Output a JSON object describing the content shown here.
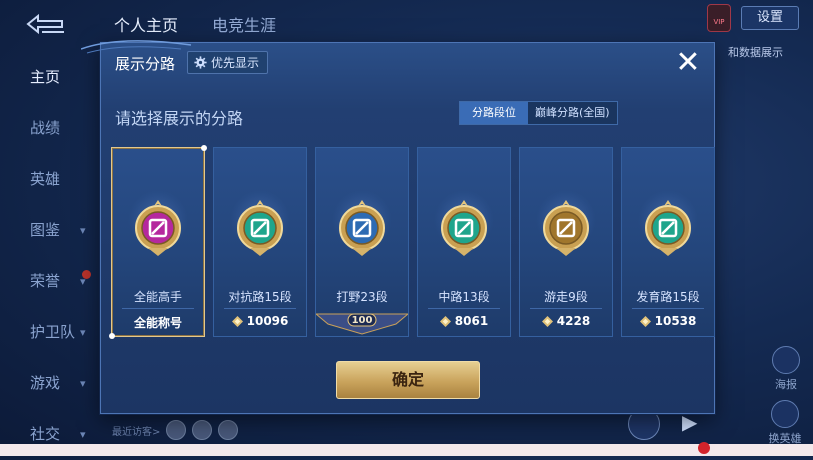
{
  "header": {
    "tabs": [
      {
        "label": "个人主页",
        "active": true
      },
      {
        "label": "电竞生涯",
        "active": false
      }
    ],
    "settings_label": "设置"
  },
  "sidebar": {
    "items": [
      {
        "label": "主页",
        "active": true,
        "has_chevron": false
      },
      {
        "label": "战绩",
        "active": false,
        "has_chevron": false
      },
      {
        "label": "英雄",
        "active": false,
        "has_chevron": false
      },
      {
        "label": "图鉴",
        "active": false,
        "has_chevron": true
      },
      {
        "label": "荣誉",
        "active": false,
        "has_chevron": true
      },
      {
        "label": "护卫队",
        "active": false,
        "has_chevron": true
      },
      {
        "label": "游戏",
        "active": false,
        "has_chevron": true
      },
      {
        "label": "社交",
        "active": false,
        "has_chevron": true
      }
    ]
  },
  "background": {
    "right_text": "和数据展示",
    "poster_label": "海报",
    "swap_hero_label": "换英雄",
    "recent_visitors_label": "最近访客>"
  },
  "modal": {
    "title": "展示分路",
    "priority_label": "优先显示",
    "subtitle": "请选择展示的分路",
    "mode_tabs": [
      {
        "label": "分路段位",
        "active": true
      },
      {
        "label": "巅峰分路(全国)",
        "active": false
      }
    ],
    "cards": [
      {
        "name": "全能高手",
        "foot": "全能称号",
        "kind": "title",
        "emblem_color": "#b5289e",
        "selected": true
      },
      {
        "name": "对抗路15段",
        "foot": "10096",
        "kind": "score",
        "emblem_color": "#1fa58c",
        "selected": false
      },
      {
        "name": "打野23段",
        "foot": "100",
        "kind": "ribbon",
        "emblem_color": "#2d6bb3",
        "selected": false
      },
      {
        "name": "中路13段",
        "foot": "8061",
        "kind": "score",
        "emblem_color": "#1fa58c",
        "selected": false
      },
      {
        "name": "游走9段",
        "foot": "4228",
        "kind": "score",
        "emblem_color": "#a0762c",
        "selected": false
      },
      {
        "name": "发育路15段",
        "foot": "10538",
        "kind": "score",
        "emblem_color": "#1fa58c",
        "selected": false
      }
    ],
    "confirm_label": "确定"
  },
  "icons": {
    "gear": "gear-icon",
    "close": "close-icon",
    "back": "back-arrow-icon",
    "diamond": "diamond-icon"
  }
}
